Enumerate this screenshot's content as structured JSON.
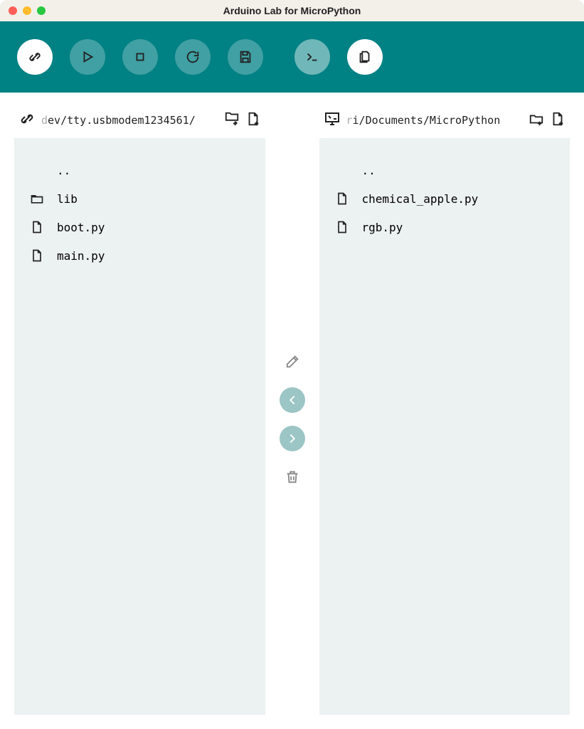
{
  "window": {
    "title": "Arduino Lab for MicroPython"
  },
  "toolbar": {
    "connect": "connect",
    "run": "run",
    "stop": "stop",
    "reset": "reset",
    "save": "save",
    "terminal": "terminal",
    "files": "files"
  },
  "left": {
    "path_faded": "d",
    "path": "ev/tty.usbmodem1234561/",
    "entries": [
      {
        "type": "up",
        "label": ".."
      },
      {
        "type": "folder",
        "label": "lib"
      },
      {
        "type": "file",
        "label": "boot.py"
      },
      {
        "type": "file",
        "label": "main.py"
      }
    ]
  },
  "right": {
    "path_faded": "r",
    "path": "i/Documents/MicroPython",
    "entries": [
      {
        "type": "up",
        "label": ".."
      },
      {
        "type": "file",
        "label": "chemical_apple.py"
      },
      {
        "type": "file",
        "label": "rgb.py"
      }
    ]
  },
  "middle": {
    "edit": "edit",
    "left": "move-left",
    "right": "move-right",
    "delete": "delete"
  }
}
